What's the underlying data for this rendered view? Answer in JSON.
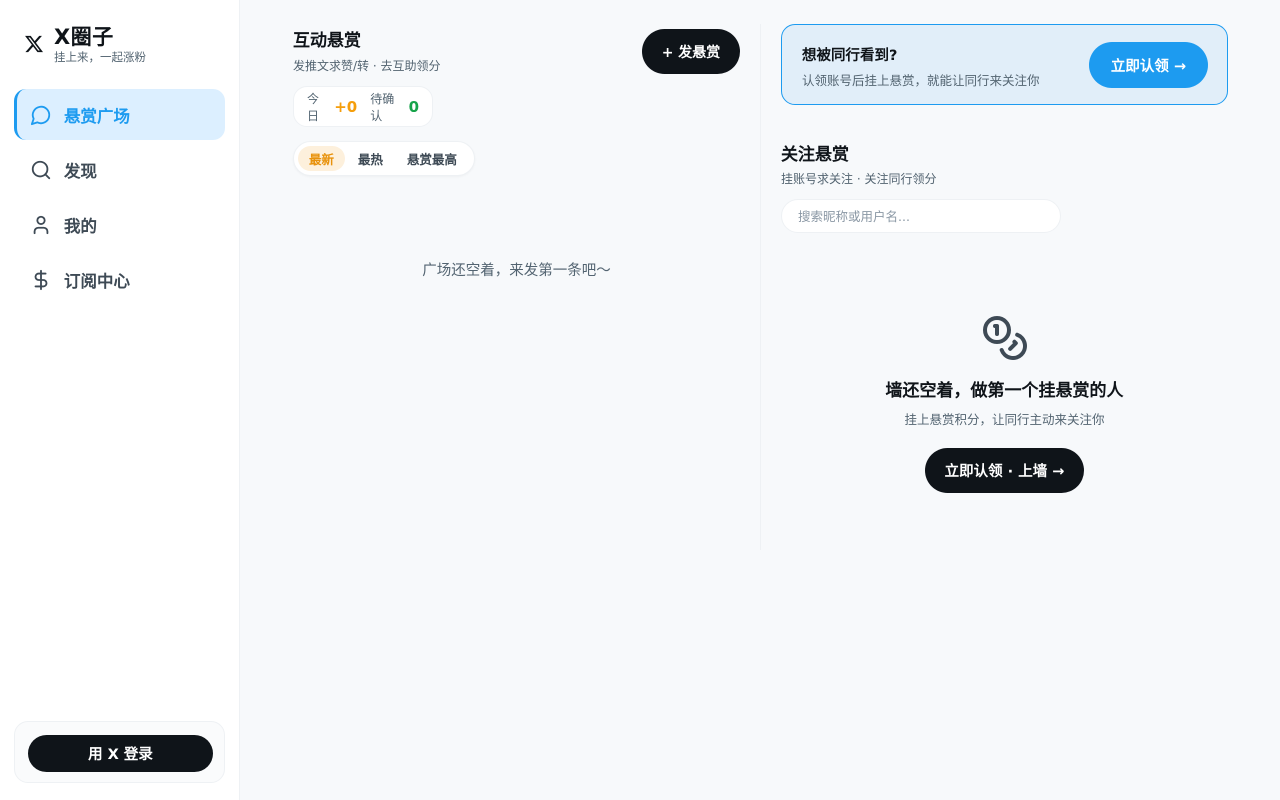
{
  "brand": {
    "name": "X圈子",
    "tagline": "挂上来，一起涨粉"
  },
  "sidebar": {
    "items": [
      {
        "label": "悬赏广场",
        "icon": "chat-bubble-icon",
        "active": true
      },
      {
        "label": "发现",
        "icon": "search-icon",
        "active": false
      },
      {
        "label": "我的",
        "icon": "user-icon",
        "active": false
      },
      {
        "label": "订阅中心",
        "icon": "dollar-icon",
        "active": false
      }
    ],
    "login_label": "用 X 登录"
  },
  "feed": {
    "title": "互动悬赏",
    "subtitle": "发推文求赞/转 · 去互助领分",
    "post_button": "+ 发悬赏",
    "stats": {
      "today_label": "今日",
      "today_value": "+0",
      "pending_label": "待确认",
      "pending_value": "0"
    },
    "tabs": [
      {
        "label": "最新",
        "active": true
      },
      {
        "label": "最热",
        "active": false
      },
      {
        "label": "悬赏最高",
        "active": false
      }
    ],
    "empty_text": "广场还空着，来发第一条吧～"
  },
  "claim": {
    "title": "想被同行看到?",
    "subtitle": "认领账号后挂上悬赏，就能让同行来关注你",
    "button": "立即认领 →"
  },
  "follow": {
    "title": "关注悬赏",
    "subtitle": "挂账号求关注 · 关注同行领分",
    "search_placeholder": "搜索昵称或用户名...",
    "empty_icon": "coins-icon",
    "empty_title": "墙还空着，做第一个挂悬赏的人",
    "empty_sub": "挂上悬赏积分，让同行主动来关注你",
    "empty_button": "立即认领 · 上墙 →"
  },
  "colors": {
    "accent": "#1d9bf0",
    "dark": "#0f1419",
    "orange": "#f59e0b",
    "green": "#16a34a"
  }
}
